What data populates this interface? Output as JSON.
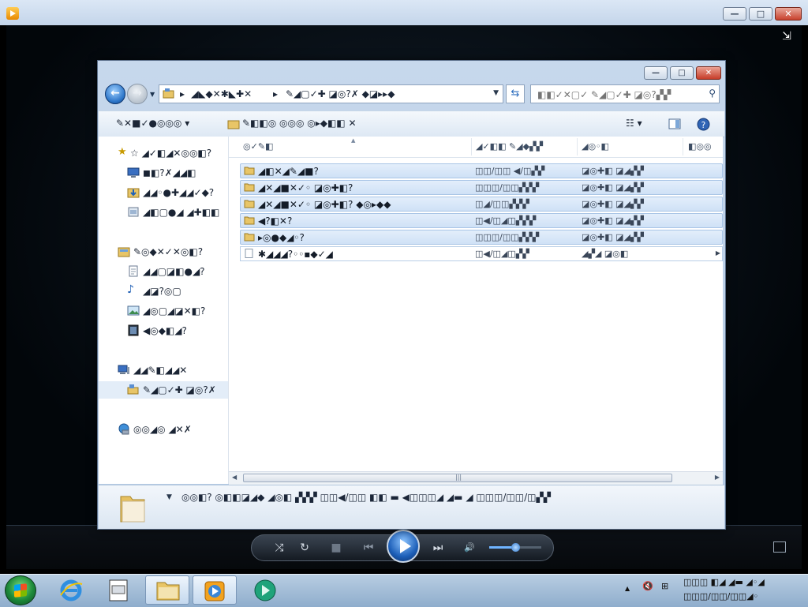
{
  "media_player": {
    "buttons": {
      "minimize": "—",
      "maximize": "□",
      "close": "✕"
    },
    "controls": {
      "shuffle": "⤨",
      "repeat": "↻",
      "stop": "■",
      "previous": "⏮",
      "next": "⏭",
      "mute": "🔊",
      "volume": 0.5
    }
  },
  "explorer": {
    "buttons": {
      "minimize": "—",
      "maximize": "□",
      "close": "✕"
    },
    "address": {
      "segments": [
        "▸",
        "◢◣◆✕✱◣✚✕",
        "▸",
        "✎◢▢✓✚ ◪◎?✗ ◆◪▸▸◆"
      ],
      "search_placeholder": "◧◧✓✕▢✓ ✎◢▢✓✚ ◪◎?▞▞"
    },
    "toolbar": {
      "organize": "✎✕■✓●◎◎◎ ▾",
      "include": "✎◧◧◎ ◎◎◎ ◎▸◆◧◧ ✕",
      "views": "☷ ▾"
    },
    "nav": {
      "favorites": "☆ ◢✓◧◢✕◎◎◧?",
      "fav_items": [
        "◼◧?✗◢◢◧",
        "◢◢◦●✚◢◢✓◆?",
        "◢◧▢●◢ ◢✚◧◧"
      ],
      "libraries": "✎◎◆✕✓✕◎◧?",
      "lib_items": [
        "◢◢▢◪◧●◢?",
        "◢◪?◎▢",
        "◢◎▢◢◪✕◧?",
        "◀◎◆◧◢?"
      ],
      "computer": "◢◢✎◧◢◢✕",
      "computer_item": "✎◢▢✓✚ ◪◎?✗",
      "network": "◎◎◢◎ ◢✕✗"
    },
    "columns": {
      "name": "◎✓✎◧",
      "date": "◢✓◧◧ ✎◢◆▞▞",
      "type": "◢◎◦◧",
      "size": "◧◎◎"
    },
    "files": [
      {
        "name": "◢◧✕◢✎◢■?",
        "date": "◫◫/◫◫ ◀/◫▞▞",
        "type": "◪◎✚◧ ◪◢▞▞",
        "kind": "folder"
      },
      {
        "name": "◢✕◢■✕✓◦ ◪◎✚◧?",
        "date": "◫◫◫/◫◫▞▞▞",
        "type": "◪◎✚◧ ◪◢▞▞",
        "kind": "folder"
      },
      {
        "name": "◢✕◢■✕✓◦ ◪◎✚◧? ◆◎▸◆◆",
        "date": "◫◢/◫◫▞▞▞",
        "type": "◪◎✚◧ ◪◢▞▞",
        "kind": "folder"
      },
      {
        "name": "◀?◧✕?",
        "date": "◫◀/◫◢◫▞▞▞",
        "type": "◪◎✚◧ ◪◢▞▞",
        "kind": "folder"
      },
      {
        "name": "▸◎●◆◢◦?",
        "date": "◫◫◫/◫◫▞▞▞",
        "type": "◪◎✚◧ ◪◢▞▞",
        "kind": "folder"
      },
      {
        "name": "✱◢◢◢?◦◦▪◆✓◢",
        "date": "◫◀/◫◢◫▞▞",
        "type": "◢▞◢ ◪◎◧",
        "kind": "file"
      }
    ],
    "details": "◎◎◧? ◎◧◧◪◢◆ ◢◎◧ ▞▞▞ ◫◫◀/◫◫ ◧◧ ▬ ◀◫◫◫◢ ◢▬ ◢ ◫◫◫/◫◫/◫▞▞"
  },
  "taskbar": {
    "tray_time": "◫◫◫ ◧◢ ◢▬ ◢◦◢",
    "tray_date": "◫◫◫/◫◫/◫◫◢◦"
  }
}
